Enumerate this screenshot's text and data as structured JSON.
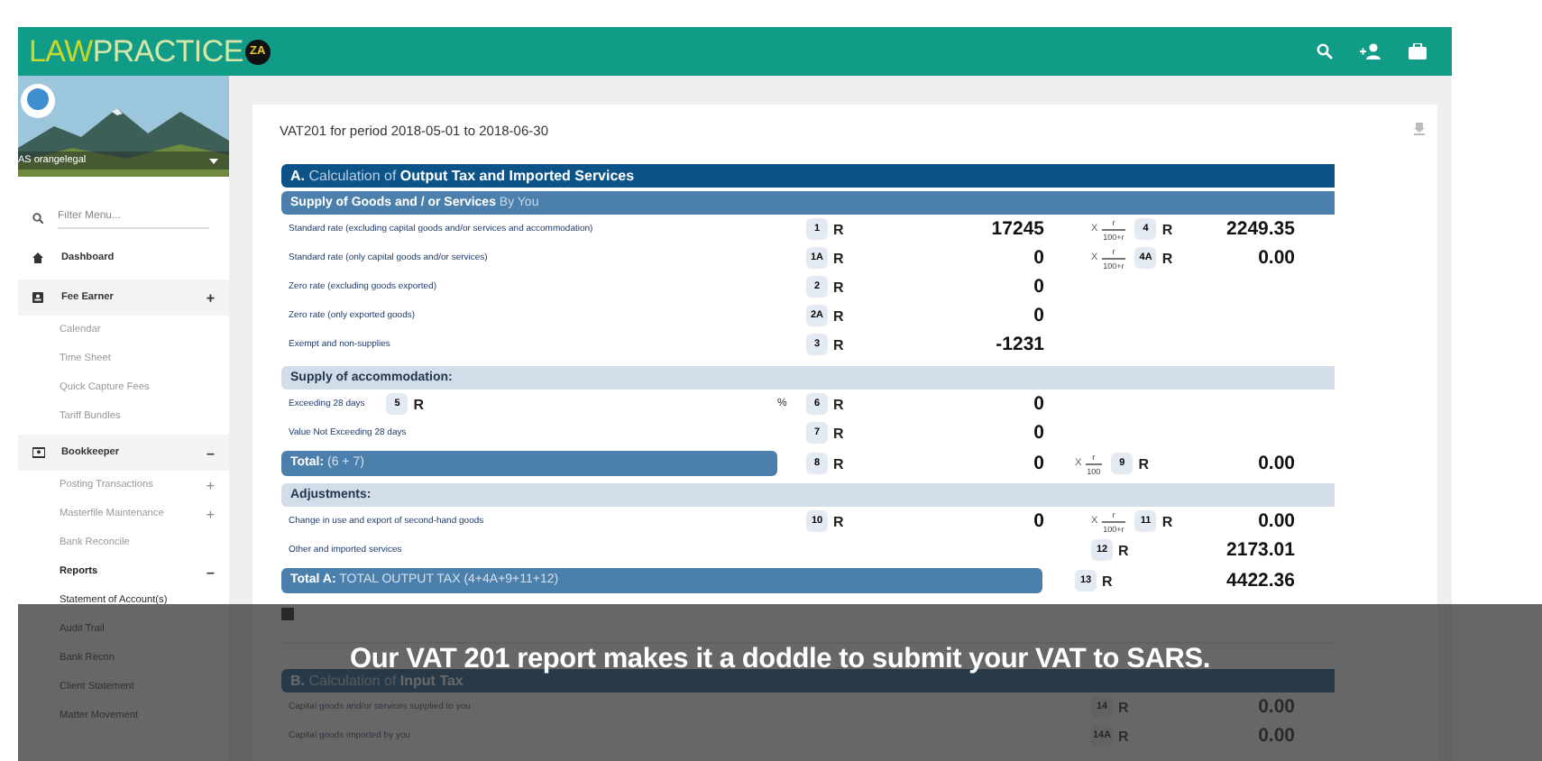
{
  "topbar": {
    "logo": {
      "first": "LAW",
      "rest": "PRACTICE",
      "badge": "ZA"
    }
  },
  "sidebar": {
    "user": "AS orangelegal",
    "filter": {
      "placeholder": "Filter Menu..."
    },
    "items": [
      {
        "label": "Dashboard",
        "selected": false
      },
      {
        "label": "Fee Earner",
        "toggle": "+",
        "selected": false,
        "children": [
          {
            "label": "Calendar",
            "selected": false
          },
          {
            "label": "Time Sheet",
            "selected": false
          },
          {
            "label": "Quick Capture Fees",
            "selected": false
          },
          {
            "label": "Tariff Bundles",
            "selected": false
          }
        ]
      },
      {
        "label": "Bookkeeper",
        "toggle": "–",
        "selected": false,
        "children": [
          {
            "label": "Posting Transactions",
            "toggle": "+",
            "selected": false
          },
          {
            "label": "Masterfile Maintenance",
            "toggle": "+",
            "selected": false
          },
          {
            "label": "Bank Reconcile",
            "selected": false
          },
          {
            "label": "Reports",
            "toggle": "–",
            "selected": true,
            "children": [
              {
                "label": "Statement of Account(s)",
                "selected": false
              },
              {
                "label": "Audit Trail",
                "selected": false
              },
              {
                "label": "Bank Recon",
                "selected": false
              },
              {
                "label": "Client Statement",
                "selected": false
              },
              {
                "label": "Matter Movement",
                "selected": false
              }
            ]
          }
        ]
      }
    ]
  },
  "report": {
    "title": "VAT201 for period 2018-05-01 to 2018-06-30",
    "blocks": [
      {
        "kind": "section",
        "text": "**A.** Calculation of **Output Tax and Imported Services**"
      },
      {
        "kind": "subhead",
        "text": "**Supply of Goods and / or Services** By You"
      },
      {
        "kind": "line",
        "label": "Standard rate (excluding capital goods and/or services and accommodation)",
        "a": {
          "code": "1",
          "currency": "R",
          "value": "17245"
        },
        "b": {
          "operator": "X",
          "numerator": "r",
          "denominator": "100+r",
          "code": "4",
          "currency": "R",
          "value": "2249.35"
        }
      },
      {
        "kind": "line",
        "label": "Standard rate (only capital goods and/or services)",
        "a": {
          "code": "1A",
          "currency": "R",
          "value": "0"
        },
        "b": {
          "operator": "X",
          "numerator": "r",
          "denominator": "100+r",
          "code": "4A",
          "currency": "R",
          "value": "0.00"
        }
      },
      {
        "kind": "line",
        "label": "Zero rate (excluding goods exported)",
        "a": {
          "code": "2",
          "currency": "R",
          "value": "0"
        }
      },
      {
        "kind": "line",
        "label": "Zero rate (only exported goods)",
        "a": {
          "code": "2A",
          "currency": "R",
          "value": "0"
        }
      },
      {
        "kind": "line",
        "label": "Exempt and non-supplies",
        "a": {
          "code": "3",
          "currency": "R",
          "value": "-1231"
        }
      },
      {
        "kind": "subhead",
        "text": "**Supply of accommodation:**"
      },
      {
        "kind": "line",
        "label": "Exceeding 28 days",
        "inline": {
          "code": "5",
          "currency": "R"
        },
        "a": {
          "prefix": "%",
          "code": "6",
          "currency": "R",
          "value": "0"
        }
      },
      {
        "kind": "line",
        "label": "Value Not Exceeding 28 days",
        "a": {
          "code": "7",
          "currency": "R",
          "value": "0"
        }
      },
      {
        "kind": "total",
        "text": "**Total:** (6 + 7)",
        "a": {
          "code": "8",
          "currency": "R",
          "value": "0"
        },
        "b": {
          "operator": "X",
          "numerator": "r",
          "denominator": "100",
          "code": "9",
          "currency": "R",
          "value": "0.00"
        }
      },
      {
        "kind": "subhead",
        "text": "**Adjustments:**"
      },
      {
        "kind": "line",
        "label": "Change in use and export of second-hand goods",
        "a": {
          "code": "10",
          "currency": "R",
          "value": "0"
        },
        "b": {
          "operator": "X",
          "numerator": "r",
          "denominator": "100+r",
          "code": "11",
          "currency": "R",
          "value": "0.00"
        }
      },
      {
        "kind": "line",
        "label": "Other and imported services",
        "b": {
          "code": "12",
          "currency": "R",
          "value": "2173.01"
        }
      },
      {
        "kind": "total",
        "text": "**Total A:** TOTAL OUTPUT TAX (4+4A+9+11+12)",
        "b": {
          "code": "13",
          "currency": "R",
          "value": "4422.36"
        }
      },
      {
        "kind": "marker"
      },
      {
        "kind": "section",
        "text": "**B.** Calculation of **Input Tax**"
      },
      {
        "kind": "line",
        "label": "Capital goods and/or services supplied to you",
        "b": {
          "code": "14",
          "currency": "R",
          "value": "0.00"
        }
      },
      {
        "kind": "line",
        "label": "Capital goods imported by you",
        "b": {
          "code": "14A",
          "currency": "R",
          "value": "0.00"
        }
      }
    ]
  },
  "caption": "Our VAT 201 report makes it a doddle to submit your VAT to SARS."
}
